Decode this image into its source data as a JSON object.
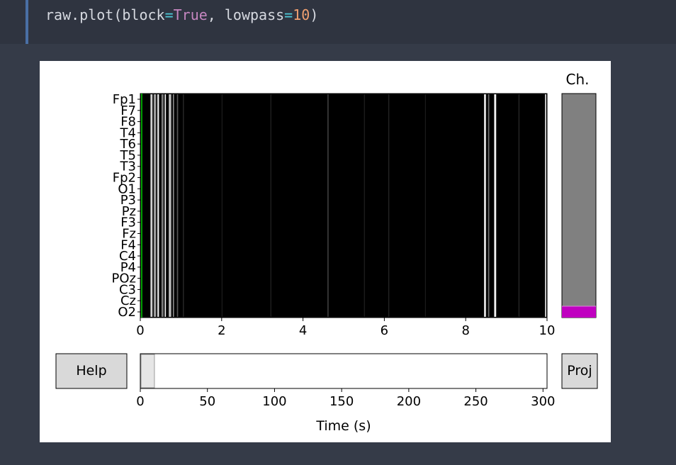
{
  "code": {
    "prefix": "raw.plot(block",
    "eq1": "=",
    "block_value": "True",
    "middle": ", lowpass",
    "eq2": "=",
    "lowpass_value": "10",
    "suffix": ")"
  },
  "figure": {
    "channel_panel_title": "Ch.",
    "channels": [
      "Fp1",
      "F7",
      "F8",
      "T4",
      "T6",
      "T5",
      "T3",
      "Fp2",
      "O1",
      "P3",
      "Pz",
      "F3",
      "Fz",
      "F4",
      "C4",
      "P4",
      "POz",
      "C3",
      "Cz",
      "O2"
    ],
    "time_ticks": [
      "0",
      "2",
      "4",
      "6",
      "8",
      "10"
    ],
    "scroll_ticks": [
      "0",
      "50",
      "100",
      "150",
      "200",
      "250",
      "300"
    ],
    "scroll_xlabel": "Time (s)",
    "help_label": "Help",
    "proj_label": "Proj",
    "colors": {
      "trace_background": "#000000",
      "channel_bar": "#808080",
      "channel_selection": "#c000c0",
      "scrollbar_thumb": "#e6e6e6",
      "button_fill": "#d9d9d9",
      "event_marker": "#00a000"
    }
  },
  "chart_data": {
    "type": "line",
    "title": "",
    "xlabel": "",
    "ylabel": "",
    "xlim": [
      0,
      10
    ],
    "x_ticks": [
      0,
      2,
      4,
      6,
      8,
      10
    ],
    "categories": [
      "Fp1",
      "F7",
      "F8",
      "T4",
      "T6",
      "T5",
      "T3",
      "Fp2",
      "O1",
      "P3",
      "Pz",
      "F3",
      "Fz",
      "F4",
      "C4",
      "P4",
      "POz",
      "C3",
      "Cz",
      "O2"
    ],
    "series": [],
    "scrollbar": {
      "xlabel": "Time (s)",
      "xlim": [
        0,
        303
      ],
      "ticks": [
        0,
        50,
        100,
        150,
        200,
        250,
        300
      ],
      "window_start_s": 0,
      "window_duration_s": 10
    }
  }
}
